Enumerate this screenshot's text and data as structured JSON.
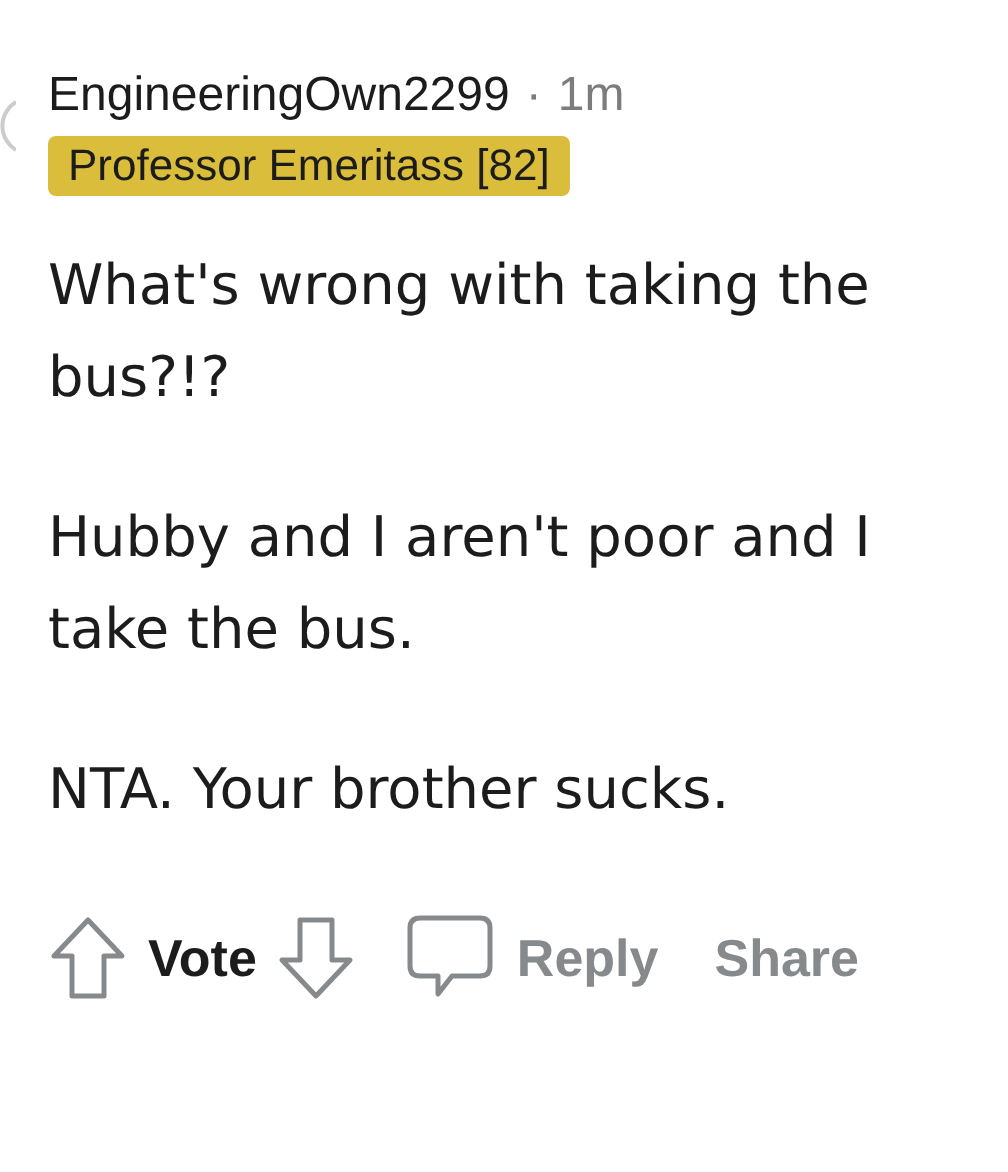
{
  "comment": {
    "author": "EngineeringOwn2299",
    "separator": "·",
    "time": "1m",
    "flair": {
      "text": "Professor Emeritass [82]",
      "color": "#dbbd3c"
    },
    "paragraphs": [
      "What's wrong with taking the bus?!?",
      "Hubby and I aren't poor and I take the bus.",
      "NTA. Your brother sucks."
    ],
    "actions": {
      "vote_label": "Vote",
      "reply_label": "Reply",
      "share_label": "Share"
    }
  }
}
